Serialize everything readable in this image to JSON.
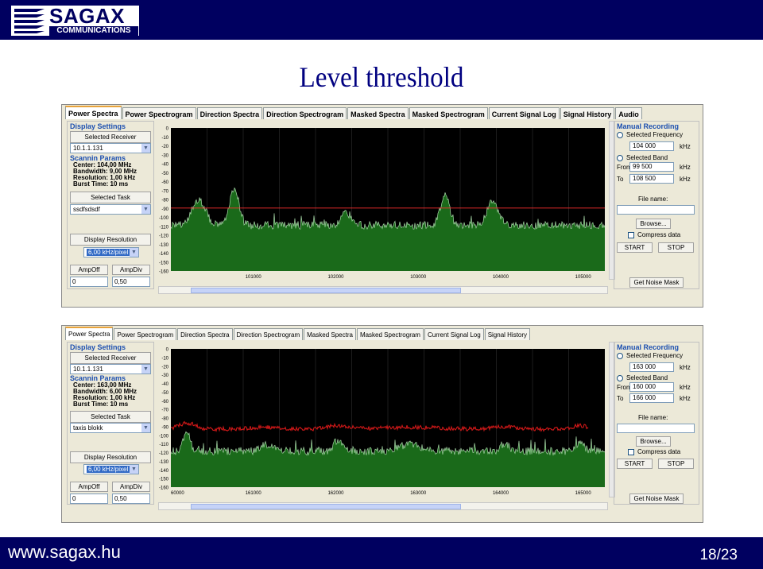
{
  "slide": {
    "title": "Level threshold",
    "footer_url": "www.sagax.hu",
    "page": "18/23",
    "logo_name": "SAGAX",
    "logo_sub": "COMMUNICATIONS"
  },
  "colors": {
    "bar": "#000060",
    "title": "#000080",
    "plot_bg": "#1a6a1a",
    "trace": "#a8d8a8",
    "threshold": "#ff3030"
  },
  "screens": [
    {
      "tabs": [
        "Power Spectra",
        "Power Spectrogram",
        "Direction Spectra",
        "Direction Spectrogram",
        "Masked Spectra",
        "Masked Spectrogram",
        "Current Signal Log",
        "Signal History",
        "Audio"
      ],
      "active_tab": 0,
      "left": {
        "display_settings": "Display Settings",
        "selected_receiver": "Selected Receiver",
        "receiver_value": "10.1.1.131",
        "scan_title": "Scannin Params",
        "params": [
          "Center: 104,00 MHz",
          "Bandwidth: 9,00 MHz",
          "Resolution: 1,00 kHz",
          "Burst Time: 10 ms"
        ],
        "selected_task": "Selected Task",
        "task_value": "ssdfsdsdf",
        "display_resolution": "Display Resolution",
        "resolution_value": "6,00 kHz/pixel",
        "ampoff_label": "AmpOff",
        "ampdiv_label": "AmpDiv",
        "ampoff_value": "0",
        "ampdiv_value": "0,50"
      },
      "chart": {
        "y_ticks": [
          "0",
          "-10",
          "-20",
          "-30",
          "-40",
          "-50",
          "-60",
          "-70",
          "-80",
          "-90",
          "-100",
          "-110",
          "-120",
          "-130",
          "-140",
          "-150",
          "-160"
        ],
        "x_ticks": [
          "101000",
          "102000",
          "103000",
          "104000",
          "105000"
        ]
      },
      "right": {
        "manual_recording": "Manual Recording",
        "selected_frequency": "Selected Frequency",
        "frequency_value": "104 000",
        "unit": "kHz",
        "selected_band": "Selected Band",
        "from_label": "From",
        "to_label": "To",
        "from_value": "99 500",
        "to_value": "108 500",
        "file_name": "File name:",
        "browse": "Browse...",
        "compress": "Compress data",
        "start": "START",
        "stop": "STOP",
        "noise_mask": "Get Noise Mask"
      }
    },
    {
      "tabs": [
        "Power Spectra",
        "Power Spectrogram",
        "Direction Spectra",
        "Direction Spectrogram",
        "Masked Spectra",
        "Masked Spectrogram",
        "Current Signal Log",
        "Signal History"
      ],
      "active_tab": 0,
      "left": {
        "display_settings": "Display Settings",
        "selected_receiver": "Selected Receiver",
        "receiver_value": "10.1.1.131",
        "scan_title": "Scannin Params",
        "params": [
          "Center: 163,00 MHz",
          "Bandwidth: 6,00 MHz",
          "Resolution: 1,00 kHz",
          "Burst Time: 10 ms"
        ],
        "selected_task": "Selected Task",
        "task_value": "taxis blokk",
        "display_resolution": "Display Resolution",
        "resolution_value": "6,00 kHz/pixel",
        "ampoff_label": "AmpOff",
        "ampdiv_label": "AmpDiv",
        "ampoff_value": "0",
        "ampdiv_value": "0,50"
      },
      "chart": {
        "y_ticks": [
          "0",
          "-10",
          "-20",
          "-30",
          "-40",
          "-50",
          "-60",
          "-70",
          "-80",
          "-90",
          "-100",
          "-110",
          "-120",
          "-130",
          "-140",
          "-150",
          "-160"
        ],
        "x_ticks": [
          "60000",
          "161000",
          "162000",
          "163000",
          "164000",
          "165000"
        ]
      },
      "right": {
        "manual_recording": "Manual Recording",
        "selected_frequency": "Selected Frequency",
        "frequency_value": "163 000",
        "unit": "kHz",
        "selected_band": "Selected Band",
        "from_label": "From",
        "to_label": "To",
        "from_value": "160 000",
        "to_value": "166 000",
        "file_name": "File name:",
        "browse": "Browse...",
        "compress": "Compress data",
        "start": "START",
        "stop": "STOP",
        "noise_mask": "Get Noise Mask"
      }
    }
  ]
}
